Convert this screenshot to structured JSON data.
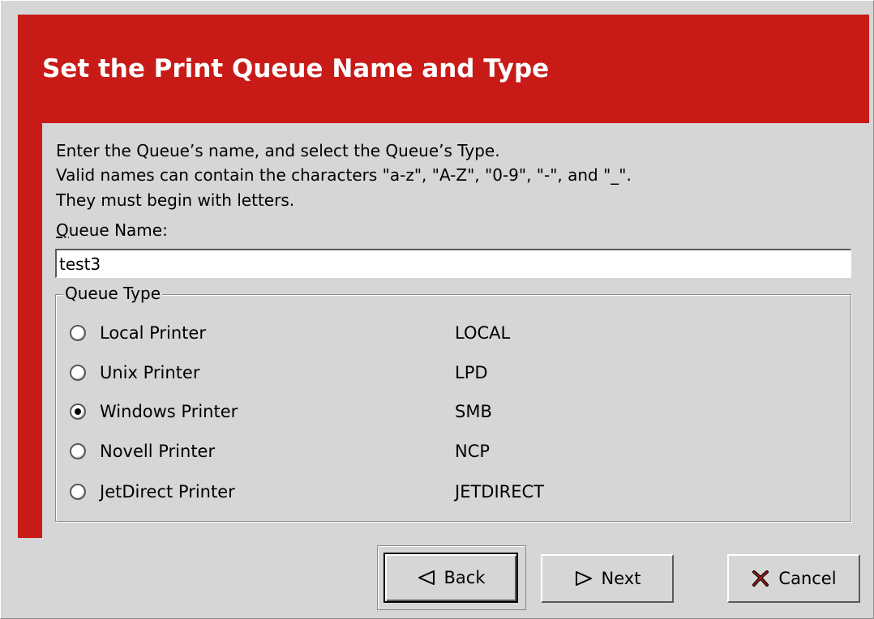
{
  "dialog": {
    "title": "Set the Print Queue Name and Type",
    "intro_lines": [
      "Enter the Queue’s name, and select the Queue’s Type.",
      "Valid names can contain the characters \"a-z\", \"A-Z\", \"0-9\", \"-\", and \"_\".",
      "They must begin with letters."
    ],
    "queue_name_label_mnemonic": "Q",
    "queue_name_label_rest": "ueue Name:",
    "queue_name_value": "test3",
    "queue_type_legend": "Queue Type",
    "queue_types": [
      {
        "label": "Local Printer",
        "type": "LOCAL",
        "checked": false
      },
      {
        "label": "Unix Printer",
        "type": "LPD",
        "checked": false
      },
      {
        "label": "Windows Printer",
        "type": "SMB",
        "checked": true
      },
      {
        "label": "Novell Printer",
        "type": "NCP",
        "checked": false
      },
      {
        "label": "JetDirect Printer",
        "type": "JETDIRECT",
        "checked": false
      }
    ]
  },
  "buttons": {
    "back": {
      "label": "Back",
      "icon": "left-arrow-icon"
    },
    "next": {
      "label": "Next",
      "icon": "right-arrow-icon"
    },
    "cancel": {
      "label": "Cancel",
      "icon": "x-cancel-icon"
    }
  },
  "colors": {
    "header_red": "#c81b18",
    "background_gray": "#d6d6d6"
  }
}
